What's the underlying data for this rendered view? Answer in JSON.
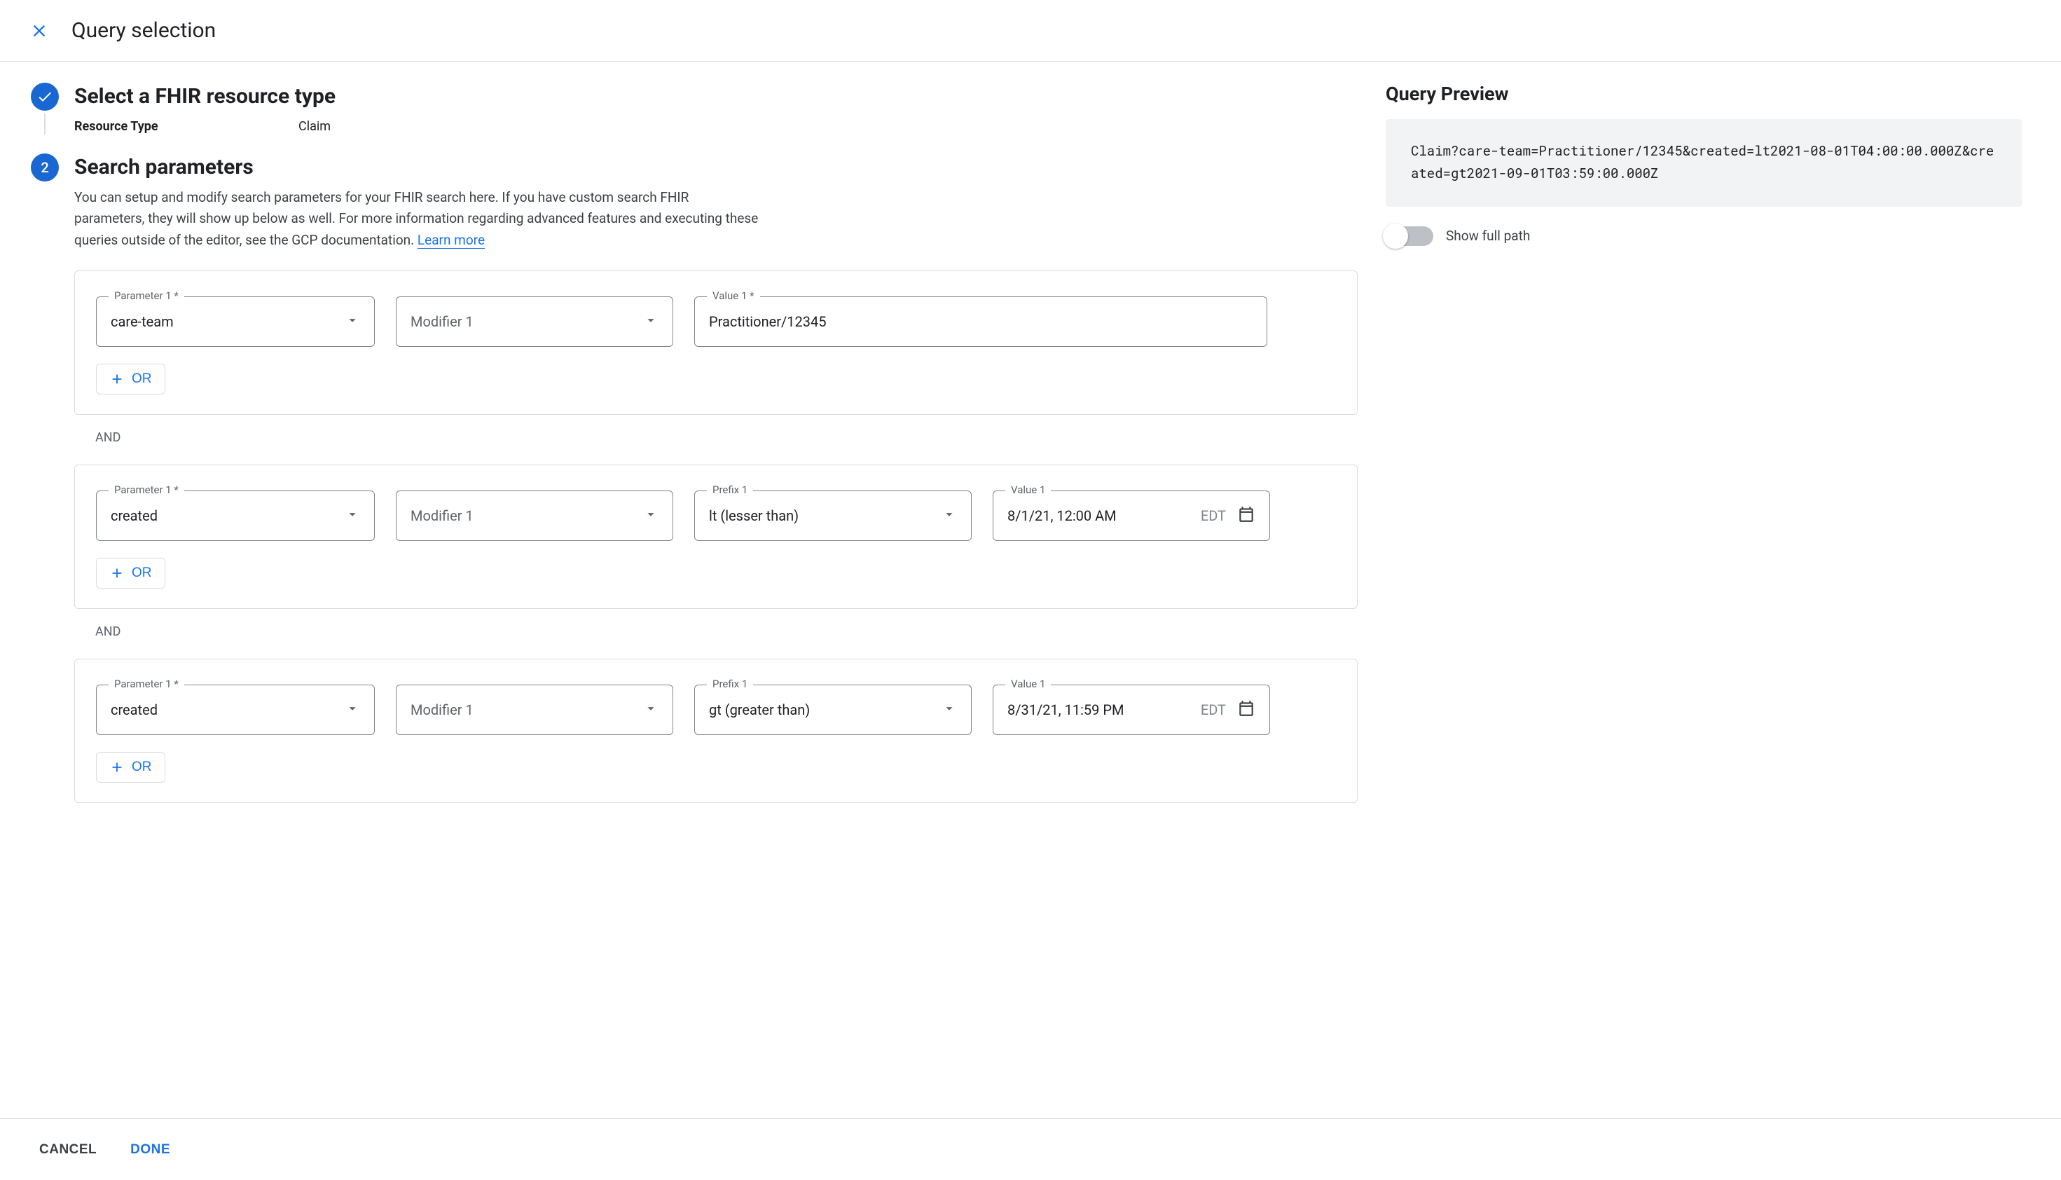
{
  "header": {
    "title": "Query selection"
  },
  "step1": {
    "title": "Select a FHIR resource type",
    "resource_type_label": "Resource Type",
    "resource_type_value": "Claim"
  },
  "step2": {
    "title": "Search parameters",
    "description": "You can setup and modify search parameters for your FHIR search here. If you have custom search FHIR parameters, they will show up below as well. For more information regarding advanced features and executing these queries outside of the editor, see the GCP documentation. ",
    "learn_more": "Learn more",
    "and_label": "AND",
    "or_button": "OR",
    "groups": [
      {
        "items": [
          {
            "parameter_label": "Parameter 1 *",
            "parameter_value": "care-team",
            "modifier_label": "Modifier 1",
            "modifier_value": "",
            "value_label": "Value 1 *",
            "value_value": "Practitioner/12345"
          }
        ]
      },
      {
        "items": [
          {
            "parameter_label": "Parameter 1 *",
            "parameter_value": "created",
            "modifier_label": "Modifier 1",
            "modifier_value": "",
            "prefix_label": "Prefix 1",
            "prefix_value": "lt (lesser than)",
            "value_label": "Value 1",
            "value_value": "8/1/21, 12:00 AM",
            "value_tz": "EDT"
          }
        ]
      },
      {
        "items": [
          {
            "parameter_label": "Parameter 1 *",
            "parameter_value": "created",
            "modifier_label": "Modifier 1",
            "modifier_value": "",
            "prefix_label": "Prefix 1",
            "prefix_value": "gt (greater than)",
            "value_label": "Value 1",
            "value_value": "8/31/21, 11:59 PM",
            "value_tz": "EDT"
          }
        ]
      }
    ]
  },
  "preview": {
    "title": "Query Preview",
    "text": "Claim?care-team=Practitioner/12345&created=lt2021-08-01T04:00:00.000Z&created=gt2021-09-01T03:59:00.000Z",
    "toggle_label": "Show full path"
  },
  "footer": {
    "cancel": "CANCEL",
    "done": "DONE"
  }
}
